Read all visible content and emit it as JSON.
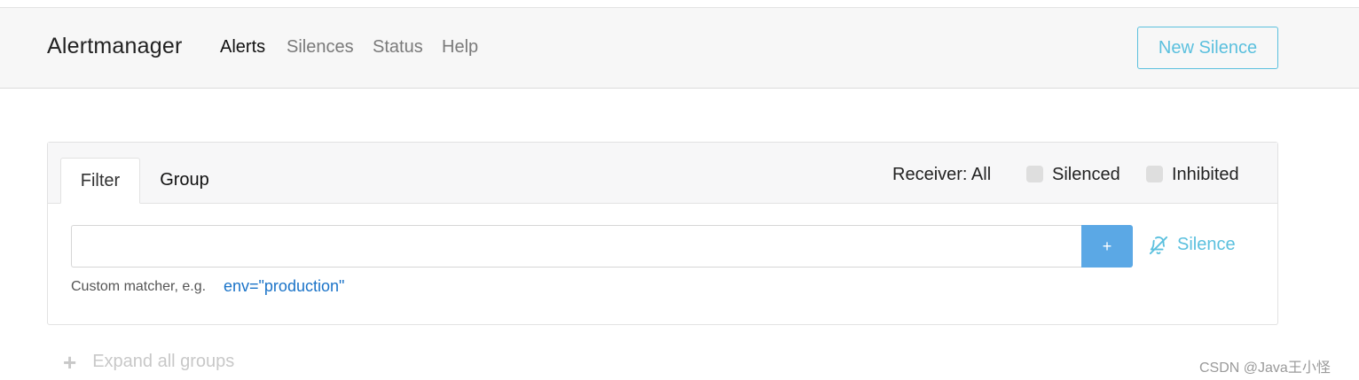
{
  "navbar": {
    "brand": "Alertmanager",
    "links": [
      "Alerts",
      "Silences",
      "Status",
      "Help"
    ],
    "new_silence_label": "New Silence"
  },
  "filter_card": {
    "tabs": [
      "Filter",
      "Group"
    ],
    "receiver_label": "Receiver: All",
    "silenced_label": "Silenced",
    "inhibited_label": "Inhibited",
    "matcher_value": "",
    "add_label": "+",
    "silence_label": "Silence",
    "hint_label": "Custom matcher, e.g.",
    "hint_example": "env=\"production\""
  },
  "expand_label": "Expand all groups",
  "watermark": "CSDN @Java王小怪",
  "colors": {
    "accent_info": "#5bc0de",
    "add_button": "#5ba8e5",
    "link_blue": "#1a73c8"
  }
}
